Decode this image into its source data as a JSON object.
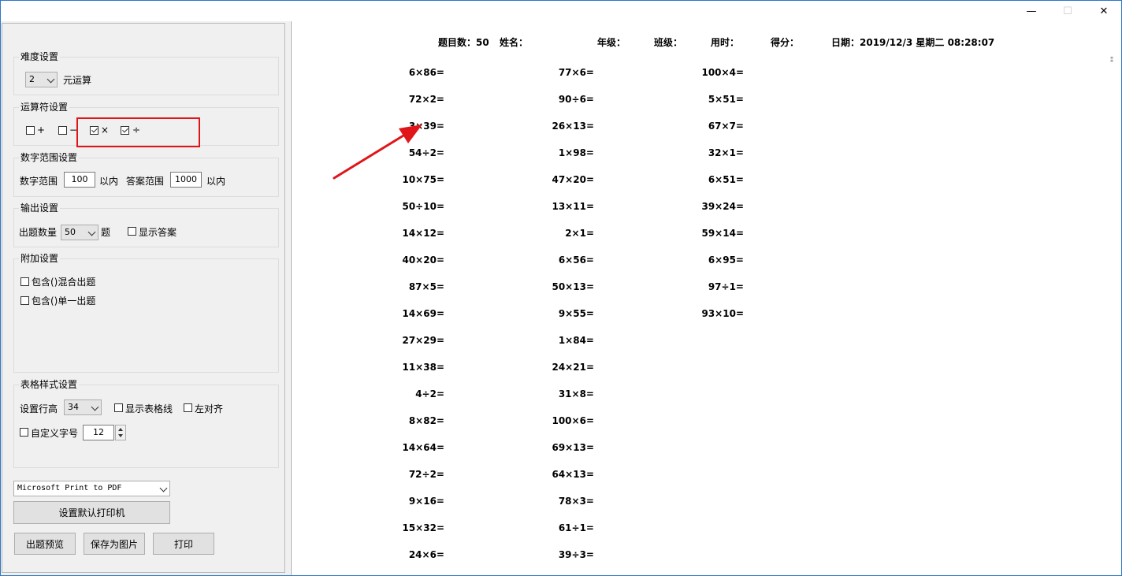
{
  "window": {
    "minimize_glyph": "—",
    "maximize_glyph": "☐",
    "close_glyph": "✕"
  },
  "settings": {
    "difficulty": {
      "title": "难度设置",
      "value": "2",
      "suffix": "元运算"
    },
    "operators": {
      "title": "运算符设置",
      "items": [
        {
          "symbol": "+",
          "checked": false
        },
        {
          "symbol": "−",
          "checked": false
        },
        {
          "symbol": "×",
          "checked": true
        },
        {
          "symbol": "÷",
          "checked": true
        }
      ]
    },
    "number_range": {
      "title": "数字范围设置",
      "num_label": "数字范围",
      "num_value": "100",
      "num_suffix": "以内",
      "ans_label": "答案范围",
      "ans_value": "1000",
      "ans_suffix": "以内"
    },
    "output": {
      "title": "输出设置",
      "count_label": "出题数量",
      "count_value": "50",
      "count_suffix": "题",
      "show_answer_label": "显示答案"
    },
    "extra": {
      "title": "附加设置",
      "mixed_label": "包含()混合出题",
      "single_label": "包含()单一出题"
    },
    "table_style": {
      "title": "表格样式设置",
      "row_height_label": "设置行高",
      "row_height_value": "34",
      "grid_label": "显示表格线",
      "left_align_label": "左对齐",
      "custom_font_label": "自定义字号",
      "font_size_value": "12"
    },
    "printer": {
      "value": "Microsoft Print to PDF",
      "set_default_label": "设置默认打印机"
    },
    "buttons": {
      "preview": "出题预览",
      "save_image": "保存为图片",
      "print": "打印"
    }
  },
  "sheet": {
    "header": {
      "count": "题目数：50",
      "name": "姓名：",
      "grade": "年级：",
      "class": "班级：",
      "time": "用时：",
      "score": "得分：",
      "date": "日期：2019/12/3 星期二 08:28:07"
    },
    "columns": [
      [
        "6×86=",
        "72×2=",
        "3×39=",
        "54÷2=",
        "10×75=",
        "50÷10=",
        "14×12=",
        "40×20=",
        "87×5=",
        "14×69=",
        "27×29=",
        "11×38=",
        "4÷2=",
        "8×82=",
        "14×64=",
        "72÷2=",
        "9×16=",
        "15×32=",
        "24×6="
      ],
      [
        "77×6=",
        "90÷6=",
        "26×13=",
        "1×98=",
        "47×20=",
        "13×11=",
        "2×1=",
        "6×56=",
        "50×13=",
        "9×55=",
        "1×84=",
        "24×21=",
        "31×8=",
        "100×6=",
        "69×13=",
        "64×13=",
        "78×3=",
        "61÷1=",
        "39÷3="
      ],
      [
        "100×4=",
        "5×51=",
        "67×7=",
        "32×1=",
        "6×51=",
        "39×24=",
        "59×14=",
        "6×95=",
        "97÷1=",
        "93×10="
      ]
    ]
  },
  "annotation": {
    "color": "#e0151a"
  }
}
